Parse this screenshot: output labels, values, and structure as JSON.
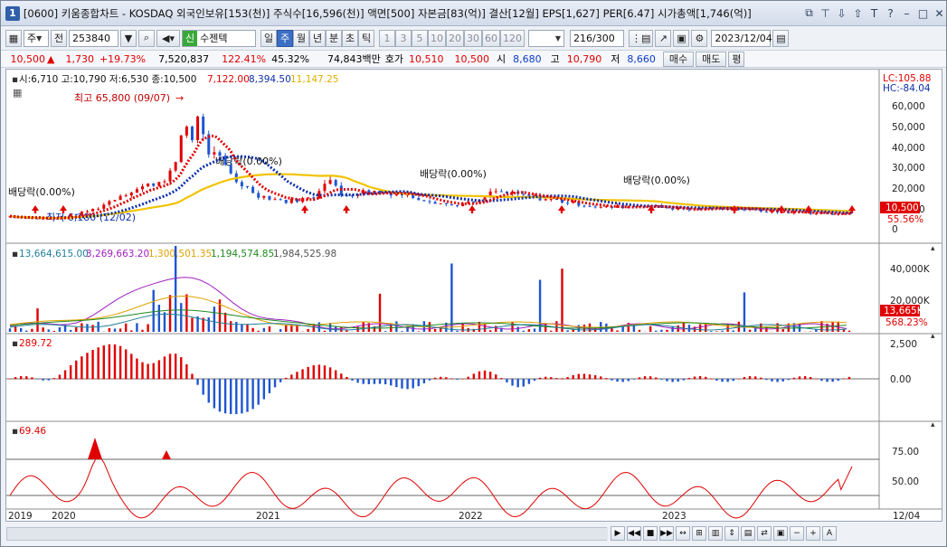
{
  "window": {
    "number": "1",
    "title": "[0600] 키움종합차트 - KOSDAQ 외국인보유[153(천)] 주식수[16,596(천)] 액면[500] 자본금[83(억)] 결산[12월] EPS[1,627] PER[6.47] 시가총액[1,746(억)]"
  },
  "toolbar": {
    "market": "주",
    "all_label": "전",
    "code": "253840",
    "badge": "신",
    "stock_name": "수젠텍",
    "periods": [
      "일",
      "주",
      "월",
      "년",
      "분",
      "초",
      "틱"
    ],
    "active_period": "주",
    "intervals": [
      "1",
      "3",
      "5",
      "10",
      "20",
      "30",
      "60",
      "120"
    ],
    "count": "216",
    "count_total": "/300",
    "date": "2023/12/04"
  },
  "quote": {
    "price": "10,500",
    "direction": "▲",
    "change": "1,730",
    "change_pct": "+19.73%",
    "volume": "7,520,837",
    "vol_ratio": "122.41%",
    "turnover": "45.32%",
    "amount": "74,843백만",
    "hoga_label": "호가",
    "ask": "10,510",
    "bid": "10,500",
    "open_label": "시",
    "open": "8,680",
    "high_label": "고",
    "high": "10,790",
    "low_label": "저",
    "low": "8,660",
    "buy_label": "매수",
    "sell_label": "매도",
    "avg_label": "평"
  },
  "colors": {
    "up": "#e00000",
    "down": "#1f55d0",
    "ma_red": "#e00000",
    "ma_blue": "#0e2fa8",
    "ma_yellow": "#f2c200",
    "vol_teal": "#1f7f99",
    "vol_purple": "#a020c0",
    "vol_orange": "#e0a000",
    "vol_green": "#1f8a1f"
  },
  "price_pane": {
    "legend_prefix": "시:6,710 고:10,790 저:6,530 종:10,500",
    "ma1": "7,122.00",
    "ma2": "8,394.50",
    "ma3": "11,147.25",
    "lc": "LC:105.88",
    "hc": "HC:-84.04",
    "high_note": "최고 65,800 (09/07)",
    "low_note": "최저 6,180 (12/02)",
    "dividends": [
      "배당락(0.00%)",
      "배당락(0.00%)",
      "배당락(0.00%)",
      "배당락(0.00%)"
    ],
    "y_labels": [
      "60,000",
      "50,000",
      "40,000",
      "30,000",
      "20,000",
      "10,000",
      "0"
    ],
    "current_price": "10,500",
    "ratio": "55.56%"
  },
  "volume_pane": {
    "v1": "13,664,615.00",
    "v2": "3,269,663.20",
    "v3": "1,300,501.35",
    "v4": "1,194,574.85",
    "v5": "1,984,525.98",
    "y_labels": [
      "40,000K",
      "20,000K"
    ],
    "current": "13,665K",
    "ratio": "568.23%"
  },
  "macd_pane": {
    "value": "289.72",
    "y_labels": [
      "2,500",
      "0.00"
    ]
  },
  "rsi_pane": {
    "value": "69.46",
    "y_labels": [
      "75.00",
      "50.00"
    ]
  },
  "x_axis": [
    "2019",
    "2020",
    "2021",
    "2022",
    "2023",
    "12/04"
  ]
}
